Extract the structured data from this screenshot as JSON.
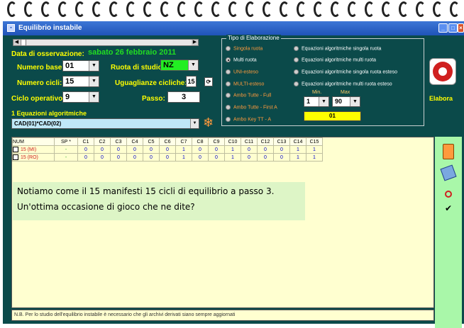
{
  "window": {
    "title": "Equilibrio instabile"
  },
  "form": {
    "data_label": "Data di osservazione:",
    "data_value": "sabato 26 febbraio 2011",
    "numero_base_label": "Numero base:",
    "numero_base_value": "01",
    "ruota_label": "Ruota di studio:",
    "ruota_value": "NZ",
    "numero_cicli_label": "Numero cicli:",
    "numero_cicli_value": "15",
    "uguaglianze_label": "Uguaglianze cicliche:",
    "uguaglianze_value": "15",
    "ciclo_label": "Ciclo operativo:",
    "ciclo_value": "9",
    "passo_label": "Passo:",
    "passo_value": "3",
    "equazioni_label": "1 Equazioni algoritmiche",
    "equazioni_value": "CAD(01)*CAD(02)"
  },
  "tipo": {
    "title": "Tipo di Elaborazione",
    "left_options": [
      "Singola ruota",
      "Multi ruota",
      "UNI-esteso",
      "MULTI-esteso",
      "Ambo Tutte - Full",
      "Ambo Tutte - First A",
      "Ambo Key TT -  A"
    ],
    "right_options": [
      "Equazioni algoritmiche singola ruota",
      "Equazioni algoritmiche multi ruota",
      "Equazioni algoritmiche singola ruota esteso",
      "Equazioni algoritmiche multi ruota esteso"
    ],
    "min_label": "Min.",
    "max_label": "Max",
    "min_value": "1",
    "max_value": "90",
    "result_value": "01"
  },
  "elabora": {
    "label": "Elabora"
  },
  "table": {
    "headers": [
      "NUM",
      "SP *",
      "C1",
      "C2",
      "C3",
      "C4",
      "C5",
      "C6",
      "C7",
      "C8",
      "C9",
      "C10",
      "C11",
      "C12",
      "C13",
      "C14",
      "C15"
    ],
    "rows": [
      {
        "num": "15 (MI)",
        "sp": "-",
        "vals": [
          "0",
          "0",
          "0",
          "0",
          "0",
          "0",
          "1",
          "0",
          "0",
          "1",
          "0",
          "0",
          "0",
          "1",
          "1"
        ]
      },
      {
        "num": "15 (RO)",
        "sp": "-",
        "vals": [
          "0",
          "0",
          "0",
          "0",
          "0",
          "0",
          "1",
          "0",
          "0",
          "1",
          "0",
          "0",
          "0",
          "1",
          "1"
        ]
      }
    ]
  },
  "note": {
    "line1": "Notiamo come il 15 manifesti 15 cicli di equilibrio a passo 3.",
    "line2": "Un'ottima occasione di gioco che ne dite?"
  },
  "footer": {
    "text": "N.B. Per lo studio dell'equilibrio instabile è necessario che gli archivi derivati siano sempre aggiornati"
  },
  "colors": {
    "window_bg": "#0b4a4a",
    "label_yellow": "#ffff00",
    "date_green": "#22dd22",
    "grid_bg": "#ffffd0",
    "note_bg": "#ddf5c6",
    "panel_green": "#a9f7a9"
  }
}
